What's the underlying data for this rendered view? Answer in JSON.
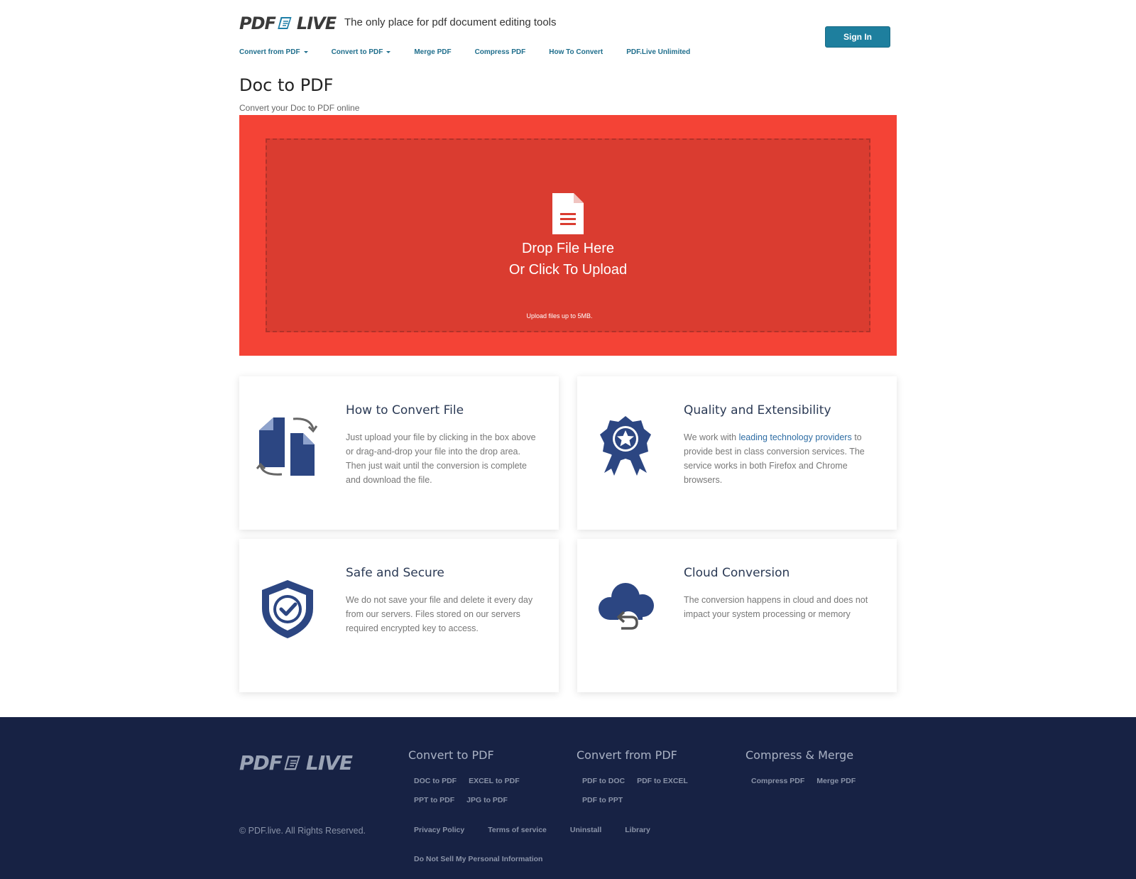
{
  "header": {
    "logo_left": "PDF",
    "logo_right": "LIVE",
    "tagline": "The only place for pdf document editing tools",
    "signin_label": "Sign In"
  },
  "nav": {
    "items": [
      {
        "label": "Convert from PDF",
        "dropdown": true
      },
      {
        "label": "Convert to PDF",
        "dropdown": true
      },
      {
        "label": "Merge PDF"
      },
      {
        "label": "Compress PDF"
      },
      {
        "label": "How To Convert"
      },
      {
        "label": "PDF.Live Unlimited"
      }
    ]
  },
  "page": {
    "title": "Doc to PDF",
    "subtitle": "Convert your Doc to PDF online"
  },
  "upload": {
    "line1": "Drop File Here",
    "line2": "Or Click To Upload",
    "limit": "Upload files up to 5MB."
  },
  "cards": [
    {
      "title": "How to Convert File",
      "text": "Just upload your file by clicking in the box above or drag-and-drop your file into the drop area. Then just wait until the conversion is complete and download the file.",
      "icon": "convert-files-icon"
    },
    {
      "title": "Quality and Extensibility",
      "text_before": "We work with ",
      "text_link": "leading technology providers",
      "text_after": " to provide best in class conversion services. The service works in both Firefox and Chrome browsers.",
      "icon": "award-badge-icon"
    },
    {
      "title": "Safe and Secure",
      "text": "We do not save your file and delete it every day from our servers. Files stored on our servers required encrypted key to access.",
      "icon": "shield-check-icon"
    },
    {
      "title": "Cloud Conversion",
      "text": "The conversion happens in cloud and does not impact your system processing or memory",
      "icon": "cloud-sync-icon"
    }
  ],
  "footer": {
    "copyright": "© PDF.live. All Rights Reserved.",
    "columns": [
      {
        "title": "Convert to PDF",
        "links": [
          "DOC to PDF",
          "EXCEL to PDF",
          "PPT to PDF",
          "JPG to PDF"
        ]
      },
      {
        "title": "Convert from PDF",
        "links": [
          "PDF to DOC",
          "PDF to EXCEL",
          "PDF to PPT"
        ]
      },
      {
        "title": "Compress & Merge",
        "links": [
          "Compress PDF",
          "Merge PDF"
        ]
      }
    ],
    "bottom_links": [
      "Privacy Policy",
      "Terms of service",
      "Uninstall",
      "Library"
    ],
    "dns_link": "Do Not Sell My Personal Information"
  },
  "colors": {
    "accent": "#1e7f9e",
    "upload_bg": "#f44336",
    "dropzone_bg": "#da3c30",
    "icon_blue": "#2c4682",
    "footer_bg": "#172244"
  }
}
